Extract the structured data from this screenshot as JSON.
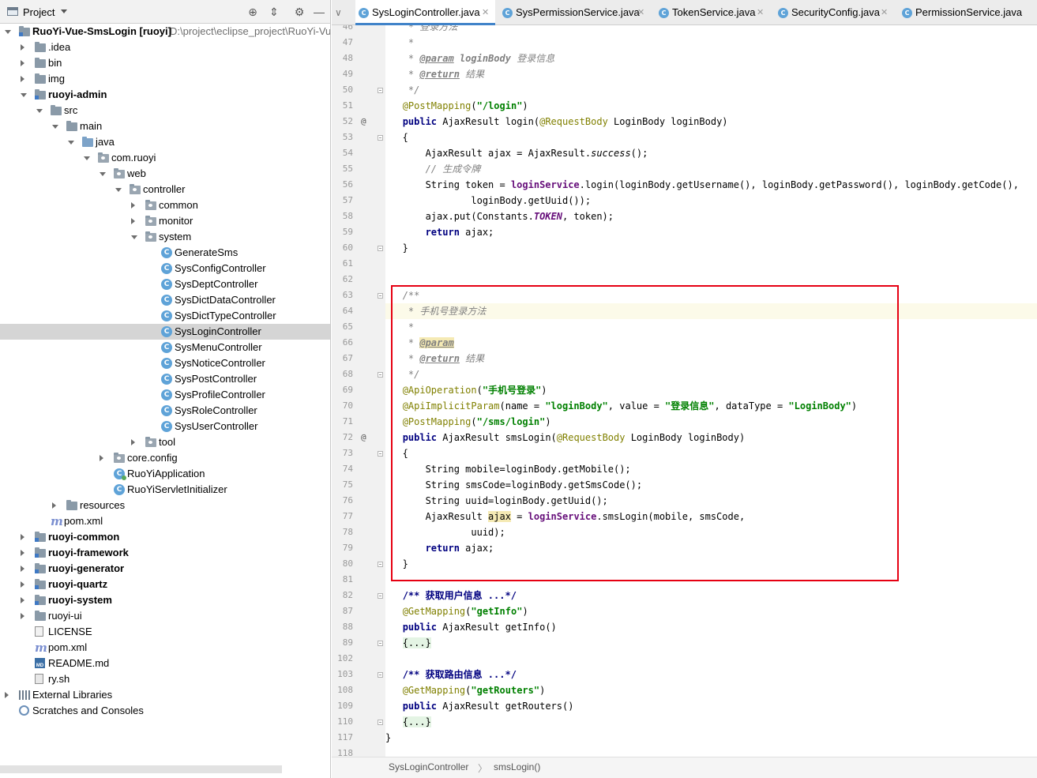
{
  "project_panel": {
    "title": "Project",
    "tree": [
      {
        "label": "RuoYi-Vue-SmsLogin [ruoyi]",
        "path": "D:\\project\\eclipse_project\\RuoYi-Vu",
        "bold": true,
        "depth": 0,
        "arrow": "down",
        "icon": "module"
      },
      {
        "label": ".idea",
        "depth": 1,
        "arrow": "right",
        "icon": "folder"
      },
      {
        "label": "bin",
        "depth": 1,
        "arrow": "right",
        "icon": "folder"
      },
      {
        "label": "img",
        "depth": 1,
        "arrow": "right",
        "icon": "folder"
      },
      {
        "label": "ruoyi-admin",
        "bold": true,
        "depth": 1,
        "arrow": "down",
        "icon": "module"
      },
      {
        "label": "src",
        "depth": 2,
        "arrow": "down",
        "icon": "folder"
      },
      {
        "label": "main",
        "depth": 3,
        "arrow": "down",
        "icon": "folder"
      },
      {
        "label": "java",
        "depth": 4,
        "arrow": "down",
        "icon": "src"
      },
      {
        "label": "com.ruoyi",
        "depth": 5,
        "arrow": "down",
        "icon": "pkg"
      },
      {
        "label": "web",
        "depth": 6,
        "arrow": "down",
        "icon": "pkg"
      },
      {
        "label": "controller",
        "depth": 7,
        "arrow": "down",
        "icon": "pkg"
      },
      {
        "label": "common",
        "depth": 8,
        "arrow": "right",
        "icon": "pkg"
      },
      {
        "label": "monitor",
        "depth": 8,
        "arrow": "right",
        "icon": "pkg"
      },
      {
        "label": "system",
        "depth": 8,
        "arrow": "down",
        "icon": "pkg"
      },
      {
        "label": "GenerateSms",
        "depth": 9,
        "icon": "class"
      },
      {
        "label": "SysConfigController",
        "depth": 9,
        "icon": "class"
      },
      {
        "label": "SysDeptController",
        "depth": 9,
        "icon": "class"
      },
      {
        "label": "SysDictDataController",
        "depth": 9,
        "icon": "class"
      },
      {
        "label": "SysDictTypeController",
        "depth": 9,
        "icon": "class"
      },
      {
        "label": "SysLoginController",
        "depth": 9,
        "icon": "class",
        "selected": true
      },
      {
        "label": "SysMenuController",
        "depth": 9,
        "icon": "class"
      },
      {
        "label": "SysNoticeController",
        "depth": 9,
        "icon": "class"
      },
      {
        "label": "SysPostController",
        "depth": 9,
        "icon": "class"
      },
      {
        "label": "SysProfileController",
        "depth": 9,
        "icon": "class"
      },
      {
        "label": "SysRoleController",
        "depth": 9,
        "icon": "class"
      },
      {
        "label": "SysUserController",
        "depth": 9,
        "icon": "class"
      },
      {
        "label": "tool",
        "depth": 8,
        "arrow": "right",
        "icon": "pkg"
      },
      {
        "label": "core.config",
        "depth": 6,
        "arrow": "right",
        "icon": "pkg"
      },
      {
        "label": "RuoYiApplication",
        "depth": 6,
        "icon": "app"
      },
      {
        "label": "RuoYiServletInitializer",
        "depth": 6,
        "icon": "class"
      },
      {
        "label": "resources",
        "depth": 3,
        "arrow": "right",
        "icon": "folder"
      },
      {
        "label": "pom.xml",
        "depth": 2,
        "icon": "maven"
      },
      {
        "label": "ruoyi-common",
        "bold": true,
        "depth": 1,
        "arrow": "right",
        "icon": "module"
      },
      {
        "label": "ruoyi-framework",
        "bold": true,
        "depth": 1,
        "arrow": "right",
        "icon": "module"
      },
      {
        "label": "ruoyi-generator",
        "bold": true,
        "depth": 1,
        "arrow": "right",
        "icon": "module"
      },
      {
        "label": "ruoyi-quartz",
        "bold": true,
        "depth": 1,
        "arrow": "right",
        "icon": "module"
      },
      {
        "label": "ruoyi-system",
        "bold": true,
        "depth": 1,
        "arrow": "right",
        "icon": "module"
      },
      {
        "label": "ruoyi-ui",
        "depth": 1,
        "arrow": "right",
        "icon": "folder"
      },
      {
        "label": "LICENSE",
        "depth": 1,
        "icon": "file"
      },
      {
        "label": "pom.xml",
        "depth": 1,
        "icon": "maven"
      },
      {
        "label": "README.md",
        "depth": 1,
        "icon": "md"
      },
      {
        "label": "ry.sh",
        "depth": 1,
        "icon": "sh"
      },
      {
        "label": "External Libraries",
        "depth": 0,
        "arrow": "right",
        "icon": "lib"
      },
      {
        "label": "Scratches and Consoles",
        "depth": 0,
        "icon": "scratch"
      }
    ]
  },
  "tabs": [
    {
      "label": "SysLoginController.java",
      "active": true
    },
    {
      "label": "SysPermissionService.java"
    },
    {
      "label": "TokenService.java"
    },
    {
      "label": "SecurityConfig.java"
    },
    {
      "label": "PermissionService.java"
    }
  ],
  "breadcrumb": {
    "class": "SysLoginController",
    "method": "smsLogin()"
  },
  "code_lines": [
    {
      "n": "46",
      "t": "    <span class=\"cmt\">* 登录方法</span>"
    },
    {
      "n": "47",
      "t": "    <span class=\"cmt\">*</span>"
    },
    {
      "n": "48",
      "t": "    <span class=\"cmt\">* </span><span class=\"tag\">@param</span><span class=\"cmt\"> </span><span class=\"cmt\" style=\"font-weight:bold\">loginBody</span><span class=\"cmt\"> 登录信息</span>"
    },
    {
      "n": "49",
      "t": "    <span class=\"cmt\">* </span><span class=\"tag\">@return</span><span class=\"cmt\"> 结果</span>"
    },
    {
      "n": "50",
      "t": "    <span class=\"cmt\">*/</span>",
      "fold": true
    },
    {
      "n": "51",
      "t": "   <span class=\"ann\">@PostMapping</span>(<span class=\"str\">\"/login\"</span>)"
    },
    {
      "n": "52",
      "t": "   <span class=\"kw\">public</span> AjaxResult login(<span class=\"ann\">@RequestBody</span> LoginBody loginBody)",
      "mark": "@"
    },
    {
      "n": "53",
      "t": "   {",
      "fold": true
    },
    {
      "n": "54",
      "t": "       AjaxResult ajax = AjaxResult.<span class=\"st\">success</span>();"
    },
    {
      "n": "55",
      "t": "       <span class=\"cmt\">// 生成令牌</span>"
    },
    {
      "n": "56",
      "t": "       String token = <span class=\"fld\">loginService</span>.login(loginBody.getUsername(), loginBody.getPassword(), loginBody.getCode(),"
    },
    {
      "n": "57",
      "t": "               loginBody.getUuid());"
    },
    {
      "n": "58",
      "t": "       ajax.put(Constants.<span class=\"stc\">TOKEN</span>, token);"
    },
    {
      "n": "59",
      "t": "       <span class=\"kw\">return</span> ajax;"
    },
    {
      "n": "60",
      "t": "   }",
      "fold": true
    },
    {
      "n": "61",
      "t": ""
    },
    {
      "n": "62",
      "t": ""
    },
    {
      "n": "63",
      "t": "   <span class=\"cmt\">/**</span>",
      "fold": true
    },
    {
      "n": "64",
      "t": "    <span class=\"cmt\">* 手机号登录方法</span>",
      "cur": true
    },
    {
      "n": "65",
      "t": "    <span class=\"cmt\">*</span>"
    },
    {
      "n": "66",
      "t": "    <span class=\"cmt\">* </span><span class=\"tag hl\">@param</span>"
    },
    {
      "n": "67",
      "t": "    <span class=\"cmt\">* </span><span class=\"tag\">@return</span><span class=\"cmt\"> 结果</span>"
    },
    {
      "n": "68",
      "t": "    <span class=\"cmt\">*/</span>",
      "fold": true
    },
    {
      "n": "69",
      "t": "   <span class=\"ann\">@ApiOperation</span>(<span class=\"str\">\"手机号登录\"</span>)"
    },
    {
      "n": "70",
      "t": "   <span class=\"ann\">@ApiImplicitParam</span>(name = <span class=\"str\">\"loginBody\"</span>, value = <span class=\"str\">\"登录信息\"</span>, dataType = <span class=\"str\">\"LoginBody\"</span>)"
    },
    {
      "n": "71",
      "t": "   <span class=\"ann\">@PostMapping</span>(<span class=\"str\">\"/sms/login\"</span>)"
    },
    {
      "n": "72",
      "t": "   <span class=\"kw\">public</span> AjaxResult smsLogin(<span class=\"ann\">@RequestBody</span> LoginBody loginBody)",
      "mark": "@"
    },
    {
      "n": "73",
      "t": "   {",
      "fold": true
    },
    {
      "n": "74",
      "t": "       String mobile=loginBody.getMobile();"
    },
    {
      "n": "75",
      "t": "       String smsCode=loginBody.getSmsCode();"
    },
    {
      "n": "76",
      "t": "       String uuid=loginBody.getUuid();"
    },
    {
      "n": "77",
      "t": "       AjaxResult <span class=\"varhl\">ajax</span> = <span class=\"fld\">loginService</span>.smsLogin(mobile, smsCode,"
    },
    {
      "n": "78",
      "t": "               uuid);"
    },
    {
      "n": "79",
      "t": "       <span class=\"kw\">return</span> ajax;"
    },
    {
      "n": "80",
      "t": "   }",
      "fold": true
    },
    {
      "n": "81",
      "t": ""
    },
    {
      "n": "82",
      "t": "   <span class=\"fcb\">/** 获取用户信息 ...*/</span>",
      "fold": true
    },
    {
      "n": "87",
      "t": "   <span class=\"ann\">@GetMapping</span>(<span class=\"str\">\"getInfo\"</span>)"
    },
    {
      "n": "88",
      "t": "   <span class=\"kw\">public</span> AjaxResult getInfo()"
    },
    {
      "n": "89",
      "t": "   <span class=\"folded\">{...}</span>",
      "fold": true
    },
    {
      "n": "102",
      "t": ""
    },
    {
      "n": "103",
      "t": "   <span class=\"fcb\">/** 获取路由信息 ...*/</span>",
      "fold": true
    },
    {
      "n": "108",
      "t": "   <span class=\"ann\">@GetMapping</span>(<span class=\"str\">\"getRouters\"</span>)"
    },
    {
      "n": "109",
      "t": "   <span class=\"kw\">public</span> AjaxResult getRouters()"
    },
    {
      "n": "110",
      "t": "   <span class=\"folded\">{...}</span>",
      "fold": true
    },
    {
      "n": "117",
      "t": "}"
    },
    {
      "n": "118",
      "t": ""
    }
  ]
}
